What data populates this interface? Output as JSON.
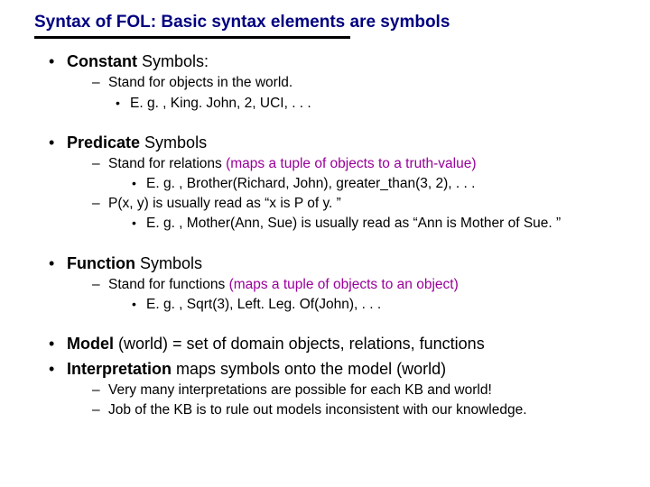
{
  "title": "Syntax of FOL: Basic syntax elements are symbols",
  "constant": {
    "head_bold": "Constant",
    "head_rest": " Symbols:",
    "stand": "Stand for objects in the world.",
    "eg": "E. g. , King. John, 2, UCI, . . ."
  },
  "predicate": {
    "head_bold": "Predicate",
    "head_rest": " Symbols",
    "stand_pre": "Stand for relations ",
    "stand_hl": "(maps a tuple of objects to a truth-value)",
    "eg1": "E. g. , Brother(Richard, John), greater_than(3, 2), . . .",
    "px": "P(x, y) is usually read as “x is P of y. ”",
    "eg2": "E. g. , Mother(Ann, Sue) is usually read as “Ann is Mother of Sue. ”"
  },
  "function": {
    "head_bold": "Function",
    "head_rest": " Symbols",
    "stand_pre": "Stand for functions ",
    "stand_hl": "(maps a tuple of objects to an object)",
    "eg": "E. g. , Sqrt(3), Left. Leg. Of(John), . . ."
  },
  "model": {
    "m_bold": "Model",
    "m_rest": " (world) = set of domain objects, relations, functions",
    "i_bold": "Interpretation",
    "i_rest": " maps symbols onto the model (world)",
    "note1": "Very many interpretations are possible for each KB and world!",
    "note2": "Job of the KB is to rule out models inconsistent with our knowledge."
  }
}
